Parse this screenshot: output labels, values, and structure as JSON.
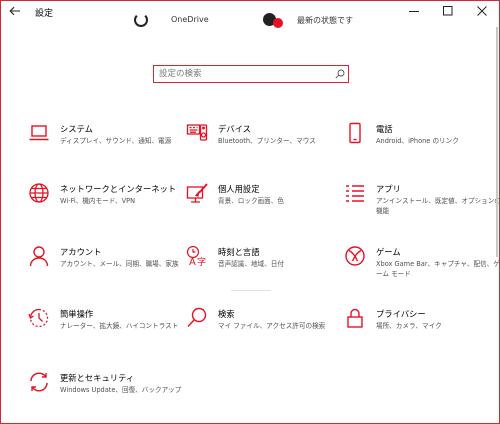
{
  "window": {
    "title": "設定",
    "accent_color": "#e81123",
    "back_icon": "arrow-left-icon",
    "controls": [
      "minimize-icon",
      "maximize-icon",
      "close-icon"
    ]
  },
  "header": {
    "left_text": "OneDrive",
    "right_text": "最新の状態です"
  },
  "search": {
    "placeholder": "設定の検索",
    "icon": "search-icon"
  },
  "tiles": [
    {
      "name": "システム",
      "desc": "ディスプレイ、サウンド、通知、電源",
      "icon": "laptop-icon"
    },
    {
      "name": "デバイス",
      "desc": "Bluetooth、プリンター、マウス",
      "icon": "keyboard-speaker-icon"
    },
    {
      "name": "電話",
      "desc": "Android、iPhone のリンク",
      "icon": "phone-icon"
    },
    {
      "name": "ネットワークとインターネット",
      "desc": "Wi-Fi、機内モード、VPN",
      "icon": "globe-icon"
    },
    {
      "name": "個人用設定",
      "desc": "背景、ロック画面、色",
      "icon": "paint-brush-icon"
    },
    {
      "name": "アプリ",
      "desc": "アンインストール、既定値、オプションの機能",
      "icon": "apps-list-icon"
    },
    {
      "name": "アカウント",
      "desc": "アカウント、メール、同期、職場、家族",
      "icon": "person-icon"
    },
    {
      "name": "時刻と言語",
      "desc": "音声認識、地域、日付",
      "icon": "time-language-icon"
    },
    {
      "name": "ゲーム",
      "desc": "Xbox Game Bar、キャプチャ、配信、ゲーム モード",
      "icon": "xbox-icon"
    },
    {
      "name": "簡単操作",
      "desc": "ナレーター、拡大鏡、ハイコントラスト",
      "icon": "ease-of-access-icon"
    },
    {
      "name": "検索",
      "desc": "マイ ファイル、アクセス許可の検索",
      "icon": "search-magnifier-icon"
    },
    {
      "name": "プライバシー",
      "desc": "場所、カメラ、マイク",
      "icon": "lock-icon"
    },
    {
      "name": "更新とセキュリティ",
      "desc": "Windows Update、回復、バックアップ",
      "icon": "sync-arrows-icon"
    }
  ]
}
